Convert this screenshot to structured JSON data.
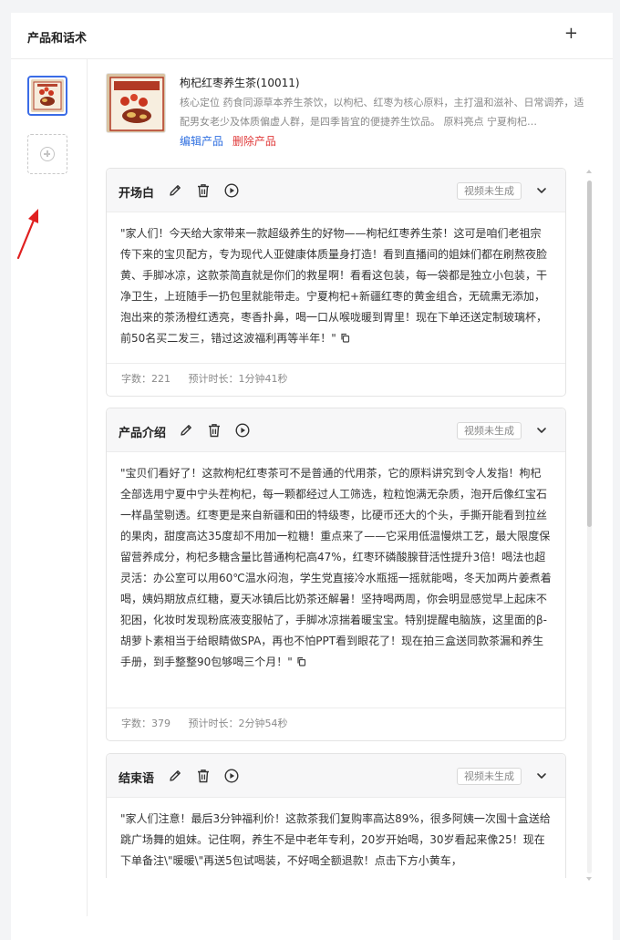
{
  "panel": {
    "title": "产品和话术",
    "add_symbol": "+"
  },
  "product": {
    "name": "枸杞红枣养生茶(10011)",
    "image_label": "枸杞红枣养生茶",
    "description": "核心定位 药食同源草本养生茶饮，以枸杞、红枣为核心原料，主打温和滋补、日常调养，适配男女老少及体质偏虚人群，是四季皆宜的便捷养生饮品。 原料亮点 宁夏枸杞…",
    "edit_label": "编辑产品",
    "delete_label": "删除产品"
  },
  "cards": [
    {
      "title": "开场白",
      "status": "视频未生成",
      "text": "\"家人们！今天给大家带来一款超级养生的好物——枸杞红枣养生茶！这可是咱们老祖宗传下来的宝贝配方，专为现代人亚健康体质量身打造！看到直播间的姐妹们都在刷熬夜脸黄、手脚冰凉，这款茶简直就是你们的救星啊！看看这包装，每一袋都是独立小包装，干净卫生，上班随手一扔包里就能带走。宁夏枸杞+新疆红枣的黄金组合，无硫熏无添加，泡出来的茶汤橙红透亮，枣香扑鼻，喝一口从喉咙暖到胃里！现在下单还送定制玻璃杯，前50名买二发三，错过这波福利再等半年！\"",
      "word_count": "字数：221",
      "duration": "预计时长：1分钟41秒"
    },
    {
      "title": "产品介绍",
      "status": "视频未生成",
      "text": "\"宝贝们看好了！这款枸杞红枣茶可不是普通的代用茶，它的原料讲究到令人发指！枸杞全部选用宁夏中宁头茬枸杞，每一颗都经过人工筛选，粒粒饱满无杂质，泡开后像红宝石一样晶莹剔透。红枣更是来自新疆和田的特级枣，比硬币还大的个头，手撕开能看到拉丝的果肉，甜度高达35度却不用加一粒糖！重点来了——它采用低温慢烘工艺，最大限度保留营养成分，枸杞多糖含量比普通枸杞高47%，红枣环磷酸腺苷活性提升3倍！喝法也超灵活：办公室可以用60℃温水闷泡，学生党直接冷水瓶摇一摇就能喝，冬天加两片姜煮着喝，姨妈期放点红糖，夏天冰镇后比奶茶还解暑！坚持喝两周，你会明显感觉早上起床不犯困，化妆时发现粉底液变服帖了，手脚冰凉揣着暖宝宝。特别提醒电脑族，这里面的β-胡萝卜素相当于给眼睛做SPA，再也不怕PPT看到眼花了！现在拍三盒送同款茶漏和养生手册，到手整整90包够喝三个月！\"",
      "word_count": "字数：379",
      "duration": "预计时长：2分钟54秒"
    },
    {
      "title": "结束语",
      "status": "视频未生成",
      "text": "\"家人们注意！最后3分钟福利价！这款茶我们复购率高达89%，很多阿姨一次囤十盒送给跳广场舞的姐妹。记住啊，养生不是中老年专利，20岁开始喝，30岁看起来像25！现在下单备注\\\"暖暖\\\"再送5包试喝装，不好喝全额退款！点击下方小黄车，",
      "word_count": "",
      "duration": ""
    }
  ],
  "colors": {
    "accent_blue": "#2f6fe0",
    "danger_red": "#e03b3b",
    "selected_border": "#3b6ce6",
    "annotation_arrow": "#e02020"
  }
}
